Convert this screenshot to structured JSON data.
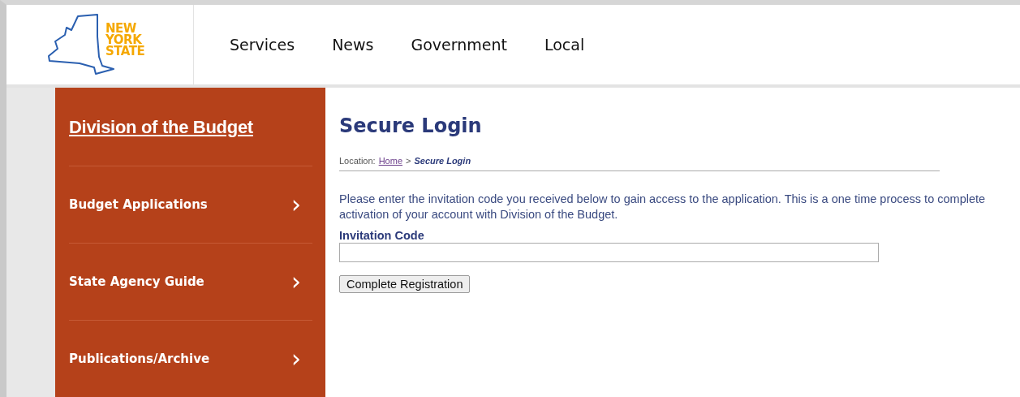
{
  "logo": {
    "lines": [
      "NEW",
      "YORK",
      "STATE"
    ]
  },
  "nav": [
    {
      "label": "Services"
    },
    {
      "label": "News"
    },
    {
      "label": "Government"
    },
    {
      "label": "Local"
    }
  ],
  "sidebar": {
    "title": "Division of the Budget",
    "items": [
      {
        "label": "Budget Applications",
        "icon": "›"
      },
      {
        "label": "State Agency Guide",
        "icon": "›"
      },
      {
        "label": "Publications/Archive",
        "icon": "›"
      }
    ]
  },
  "page": {
    "title": "Secure Login",
    "breadcrumb": {
      "prefix": "Location:",
      "link": "Home",
      "separator": ">",
      "current": "Secure Login"
    },
    "intro": "Please enter the invitation code you received below to gain access to the application. This is a one time process to complete activation of your account with Division of the Budget.",
    "field_label": "Invitation Code",
    "button": "Complete Registration"
  }
}
